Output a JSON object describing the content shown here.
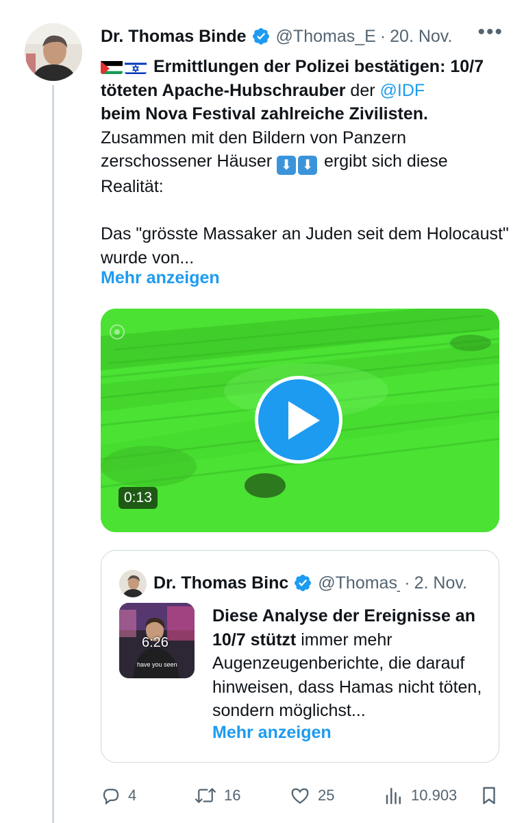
{
  "tweet": {
    "author_name": "Dr. Thomas Binde",
    "handle": "@Thomas_E",
    "separator": "·",
    "date": "20. Nov.",
    "more_label": "•••",
    "text": {
      "flags": [
        "palestine-flag",
        "israel-flag"
      ],
      "bold1": "Ermittlungen der Polizei bestätigen: 10/7 töteten Apache-Hubschrauber",
      "plain1": " der ",
      "mention": "@IDF",
      "bold2": "beim Nova Festival zahlreiche Zivilisten.",
      "plain2": "Zusammen mit den Bildern von Panzern zerschossener Häuser",
      "arrows": [
        "⬇",
        "⬇"
      ],
      "plain3": " ergibt sich diese Realität:",
      "paragraph2": "Das \"grösste Massaker an Juden seit dem Holocaust\" wurde von..."
    },
    "show_more": "Mehr anzeigen",
    "video": {
      "duration": "0:13",
      "colors": {
        "green": "#4be233",
        "play": "#1d9bf0"
      }
    },
    "quote": {
      "author_name": "Dr. Thomas Binc",
      "handle": "@Thomas_",
      "separator": "·",
      "date": "2. Nov.",
      "thumbnail_duration": "6:26",
      "thumbnail_caption": "have you seen",
      "bold": "Diese Analyse der Ereignisse an 10/7 stützt",
      "plain": " immer mehr Augenzeugenberichte, die darauf hinweisen, dass Hamas nicht töten, sondern möglichst...",
      "show_more": "Mehr anzeigen"
    },
    "actions": {
      "replies": "4",
      "retweets": "16",
      "likes": "25",
      "views": "10.903"
    }
  },
  "colors": {
    "accent": "#1d9bf0",
    "secondary_text": "#536471",
    "border": "#cfd9de"
  }
}
